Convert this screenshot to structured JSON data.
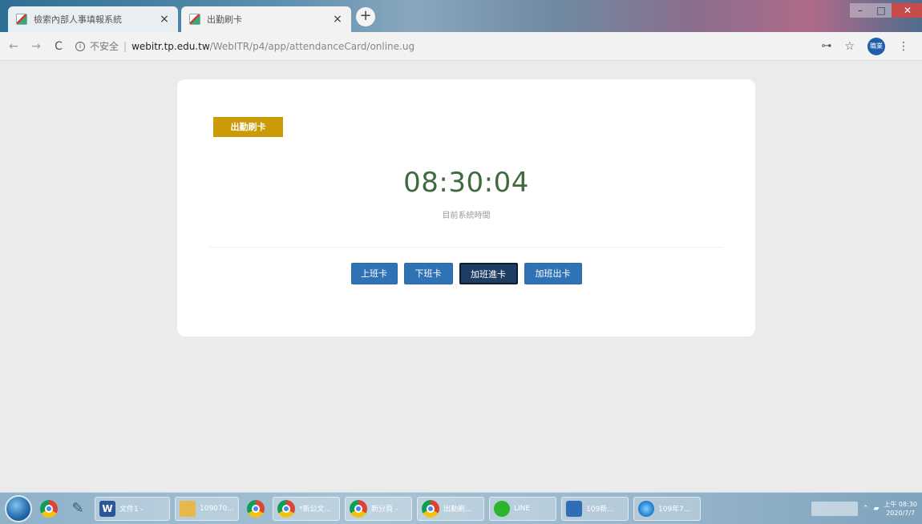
{
  "browser": {
    "tabs": [
      {
        "title": "檢索內部人事填報系統",
        "active": false
      },
      {
        "title": "出勤刷卡",
        "active": true
      }
    ],
    "new_tab_label": "+",
    "close_glyph": "×",
    "address": {
      "security": "不安全",
      "separator": "|",
      "host": "webitr.tp.edu.tw",
      "path": "/WebITR/p4/app/attendanceCard/online.ug"
    },
    "profile_initials": "職業"
  },
  "card": {
    "badge": "出勤刷卡",
    "time": "08:30:04",
    "caption": "目前系統時間",
    "buttons": [
      {
        "id": "btn-in",
        "label": "上班卡",
        "active": false
      },
      {
        "id": "btn-out",
        "label": "下班卡",
        "active": false
      },
      {
        "id": "btn-otin",
        "label": "加班進卡",
        "active": true
      },
      {
        "id": "btn-otout",
        "label": "加班出卡",
        "active": false
      }
    ]
  },
  "taskbar": {
    "tasks": [
      {
        "label": "文件1 -",
        "icon": "word-icon"
      },
      {
        "label": "109070...",
        "icon": "folder-icon"
      },
      {
        "label": "*新公文...",
        "icon": "chrome-icon"
      },
      {
        "label": "新分頁 -",
        "icon": "chrome-icon"
      },
      {
        "label": "出勤刷...",
        "icon": "chrome-icon"
      },
      {
        "label": "LINE",
        "icon": "line-icon"
      },
      {
        "label": "109新...",
        "icon": "teams-icon"
      },
      {
        "label": "109年7...",
        "icon": "ie-icon"
      }
    ],
    "clock_time": "上午 08:30",
    "clock_date": "2020/7/7"
  },
  "icons": {
    "back": "←",
    "forward": "→",
    "reload": "C",
    "info": "i",
    "key": "⊶",
    "star": "☆",
    "menu": "⋮"
  },
  "colors": {
    "badge": "#cc9a06",
    "clock_text": "#3f6a3f",
    "button": "#2f73b6",
    "button_active": "#1f3d63"
  }
}
